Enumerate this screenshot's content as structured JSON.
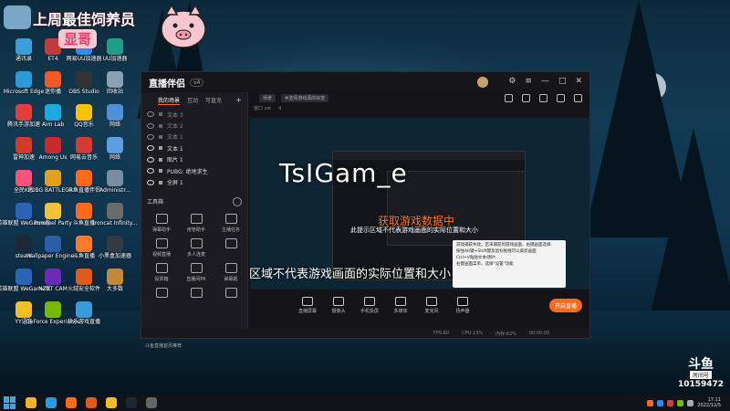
{
  "badge": {
    "title": "上周最佳饲养员",
    "name": "显哥"
  },
  "desktop_icons": [
    {
      "label": "Sleeper",
      "color": "#4c7ea8"
    },
    {
      "label": "此电脑",
      "color": "#3b8bd0"
    },
    {
      "label": "Origin",
      "color": "#f26b21"
    },
    {
      "label": "回收站",
      "color": "#8fa4b8"
    },
    {
      "label": "通讯录",
      "color": "#3aa0d8"
    },
    {
      "label": "ET4",
      "color": "#c23a3a"
    },
    {
      "label": "网易UU加速器",
      "color": "#2d8cf0"
    },
    {
      "label": "UU加速器",
      "color": "#1f9e8a"
    },
    {
      "label": "Microsoft Edge",
      "color": "#2a9bd8"
    },
    {
      "label": "迷你播",
      "color": "#f05a28"
    },
    {
      "label": "OBS Studio",
      "color": "#333333"
    },
    {
      "label": "回收站",
      "color": "#8aa0b4"
    },
    {
      "label": "腾讯手游加速",
      "color": "#e43b3b"
    },
    {
      "label": "Aim Lab",
      "color": "#1fa8e0"
    },
    {
      "label": "QQ音乐",
      "color": "#f8c400"
    },
    {
      "label": "网络",
      "color": "#4f8fd8"
    },
    {
      "label": "雷神加速",
      "color": "#d23a2a"
    },
    {
      "label": "Among Us",
      "color": "#c72a2a"
    },
    {
      "label": "网易云音乐",
      "color": "#d33a31"
    },
    {
      "label": "网络",
      "color": "#5aa0e0"
    },
    {
      "label": "全民K歌",
      "color": "#ff4f7b"
    },
    {
      "label": "PUBG BATTLEGR...",
      "color": "#e0a020"
    },
    {
      "label": "斗鱼直播伴侣",
      "color": "#ff6a1a"
    },
    {
      "label": "Administr...",
      "color": "#7a8ca0"
    },
    {
      "label": "英雄联盟 WeGame版",
      "color": "#2a63b8"
    },
    {
      "label": "Pummel Party",
      "color": "#f2c33a"
    },
    {
      "label": "斗鱼直播",
      "color": "#ff6a1a"
    },
    {
      "label": "Ironcat Infinity...",
      "color": "#6b6b6b"
    },
    {
      "label": "steam",
      "color": "#1b2838"
    },
    {
      "label": "Wallpaper Engine...",
      "color": "#2a5fa8"
    },
    {
      "label": "斗鱼直播",
      "color": "#ff7a2a"
    },
    {
      "label": "小黑盒加速器",
      "color": "#333a44"
    },
    {
      "label": "英雄联盟 WeGame版",
      "color": "#2a63b8"
    },
    {
      "label": "NZXT CAM",
      "color": "#6a2ab8"
    },
    {
      "label": "火绒安全软件",
      "color": "#e05a1a"
    },
    {
      "label": "大多数",
      "color": "#c08a3a"
    },
    {
      "label": "YY语音",
      "color": "#f0c020"
    },
    {
      "label": "GeForce Experience",
      "color": "#76b900"
    },
    {
      "label": "快乐游戏直播",
      "color": "#3a9ad8"
    }
  ],
  "app": {
    "title": "直播伴侣",
    "version": "v4",
    "tabs": [
      "我的场景",
      "互动",
      "可直充"
    ],
    "sources": [
      {
        "label": "文本 3",
        "visible": false
      },
      {
        "label": "文本 2",
        "visible": false
      },
      {
        "label": "文本 1",
        "visible": false
      },
      {
        "label": "文本 1",
        "visible": true
      },
      {
        "label": "图片 1",
        "visible": true
      },
      {
        "label": "PUBG: 绝地求生",
        "visible": true
      },
      {
        "label": "全屏 1",
        "visible": true
      }
    ],
    "toolbox_label": "工具箱",
    "tools": [
      "弹幕助手",
      "房管助手",
      "主播任务",
      "视频直播",
      "多人连麦",
      "",
      "投票箱",
      "直播间PK",
      "弹幕姬",
      "",
      "",
      ""
    ],
    "bottom_note": "斗鱼直播首页推荐",
    "scene_chips": [
      "场景",
      "#选择游戏源的标签"
    ],
    "subbar": [
      "窗口 sxt",
      "4"
    ],
    "preview": {
      "big_text": "TsIGam_e",
      "mid_text": "获取游戏数据中",
      "small_text": "此提示区域不代表游戏画面的实际位置和大小",
      "bottom_text": "此提示区域不代表游戏画面的实际位置和大小",
      "tip_lines": [
        "游戏捕获失败，若未捕获到游戏画面，右键画面选择",
        "按住Alt键+Shift键及鼠标拖拽可以裁剪画面",
        "Ctrl+V粘贴文本/图片",
        "右键画面菜单，选择\"设置\"功能"
      ]
    },
    "controls": [
      "直播屏幕",
      "摄像头",
      "手机投屏",
      "多媒体",
      "麦克风",
      "扬声器"
    ],
    "start_label": "开启直播",
    "status": [
      "FPS:60",
      "CPU:13%",
      "内存:62%",
      "00:00:00"
    ]
  },
  "watermark": {
    "logo": "斗鱼",
    "room_label": "房间号",
    "room_number": "10159472"
  },
  "taskbar": {
    "time": "17:11",
    "date": "2022/12/5"
  }
}
